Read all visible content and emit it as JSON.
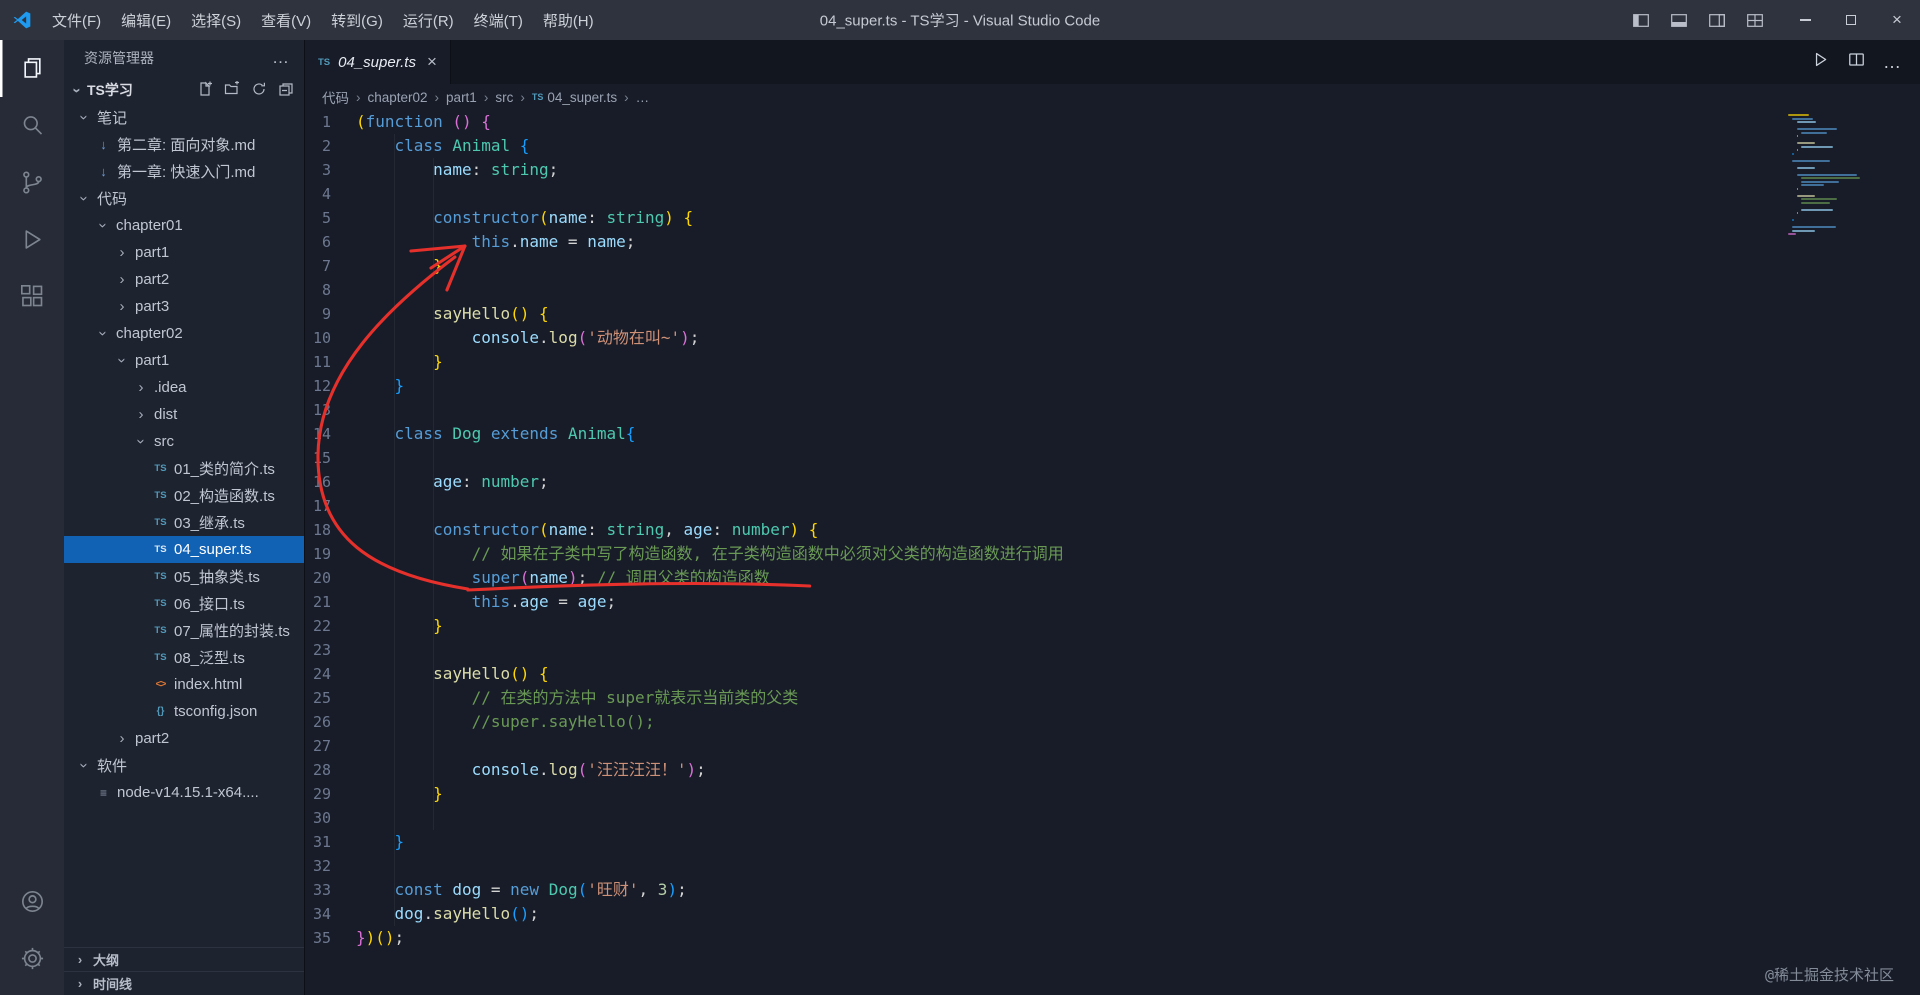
{
  "window": {
    "title": "04_super.ts - TS学习 - Visual Studio Code",
    "menus": [
      "文件(F)",
      "编辑(E)",
      "选择(S)",
      "查看(V)",
      "转到(G)",
      "运行(R)",
      "终端(T)",
      "帮助(H)"
    ]
  },
  "activity_bar": {
    "items": [
      "explorer",
      "search",
      "source-control",
      "run-debug",
      "extensions"
    ],
    "bottom": [
      "account",
      "settings"
    ]
  },
  "sidebar": {
    "title": "资源管理器",
    "section": "TS学习",
    "tree": [
      {
        "label": "笔记",
        "depth": 0,
        "kind": "folder",
        "expanded": true
      },
      {
        "label": "第二章: 面向对象.md",
        "depth": 1,
        "kind": "md"
      },
      {
        "label": "第一章: 快速入门.md",
        "depth": 1,
        "kind": "md"
      },
      {
        "label": "代码",
        "depth": 0,
        "kind": "folder",
        "expanded": true
      },
      {
        "label": "chapter01",
        "depth": 1,
        "kind": "folder",
        "expanded": true
      },
      {
        "label": "part1",
        "depth": 2,
        "kind": "folder",
        "expanded": false
      },
      {
        "label": "part2",
        "depth": 2,
        "kind": "folder",
        "expanded": false
      },
      {
        "label": "part3",
        "depth": 2,
        "kind": "folder",
        "expanded": false
      },
      {
        "label": "chapter02",
        "depth": 1,
        "kind": "folder",
        "expanded": true
      },
      {
        "label": "part1",
        "depth": 2,
        "kind": "folder",
        "expanded": true
      },
      {
        "label": ".idea",
        "depth": 3,
        "kind": "folder",
        "expanded": false
      },
      {
        "label": "dist",
        "depth": 3,
        "kind": "folder",
        "expanded": false
      },
      {
        "label": "src",
        "depth": 3,
        "kind": "folder",
        "expanded": true
      },
      {
        "label": "01_类的简介.ts",
        "depth": 4,
        "kind": "ts"
      },
      {
        "label": "02_构造函数.ts",
        "depth": 4,
        "kind": "ts"
      },
      {
        "label": "03_继承.ts",
        "depth": 4,
        "kind": "ts"
      },
      {
        "label": "04_super.ts",
        "depth": 4,
        "kind": "ts",
        "selected": true
      },
      {
        "label": "05_抽象类.ts",
        "depth": 4,
        "kind": "ts"
      },
      {
        "label": "06_接口.ts",
        "depth": 4,
        "kind": "ts"
      },
      {
        "label": "07_属性的封装.ts",
        "depth": 4,
        "kind": "ts"
      },
      {
        "label": "08_泛型.ts",
        "depth": 4,
        "kind": "ts"
      },
      {
        "label": "index.html",
        "depth": 4,
        "kind": "html"
      },
      {
        "label": "tsconfig.json",
        "depth": 4,
        "kind": "json"
      },
      {
        "label": "part2",
        "depth": 2,
        "kind": "folder",
        "expanded": false
      },
      {
        "label": "软件",
        "depth": 0,
        "kind": "folder",
        "expanded": true
      },
      {
        "label": "node-v14.15.1-x64....",
        "depth": 1,
        "kind": "file"
      }
    ],
    "panels": [
      "大纲",
      "时间线"
    ]
  },
  "editor": {
    "tab": {
      "label": "04_super.ts"
    },
    "breadcrumbs": [
      {
        "label": "代码"
      },
      {
        "label": "chapter02"
      },
      {
        "label": "part1"
      },
      {
        "label": "src"
      },
      {
        "label": "04_super.ts",
        "icon": "ts"
      },
      {
        "label": "…"
      }
    ],
    "line_count": 35,
    "lines": [
      [
        [
          "b1",
          "("
        ],
        [
          "kw",
          "function"
        ],
        [
          "pln",
          " "
        ],
        [
          "b2",
          "()"
        ],
        [
          "pln",
          " "
        ],
        [
          "b2",
          "{"
        ]
      ],
      [
        [
          "pln",
          "    "
        ],
        [
          "kw",
          "class"
        ],
        [
          "pln",
          " "
        ],
        [
          "cls",
          "Animal"
        ],
        [
          "pln",
          " "
        ],
        [
          "b3",
          "{"
        ]
      ],
      [
        [
          "pln",
          "        "
        ],
        [
          "prop",
          "name"
        ],
        [
          "pln",
          ": "
        ],
        [
          "cls",
          "string"
        ],
        [
          "pln",
          ";"
        ]
      ],
      [],
      [
        [
          "pln",
          "        "
        ],
        [
          "kw",
          "constructor"
        ],
        [
          "b1",
          "("
        ],
        [
          "prop",
          "name"
        ],
        [
          "pln",
          ": "
        ],
        [
          "cls",
          "string"
        ],
        [
          "b1",
          ")"
        ],
        [
          "pln",
          " "
        ],
        [
          "b1",
          "{"
        ]
      ],
      [
        [
          "pln",
          "            "
        ],
        [
          "kw",
          "this"
        ],
        [
          "pln",
          "."
        ],
        [
          "prop",
          "name"
        ],
        [
          "pln",
          " = "
        ],
        [
          "prop",
          "name"
        ],
        [
          "pln",
          ";"
        ]
      ],
      [
        [
          "pln",
          "        "
        ],
        [
          "b1",
          "}"
        ]
      ],
      [],
      [
        [
          "pln",
          "        "
        ],
        [
          "fn",
          "sayHello"
        ],
        [
          "b1",
          "()"
        ],
        [
          "pln",
          " "
        ],
        [
          "b1",
          "{"
        ]
      ],
      [
        [
          "pln",
          "            "
        ],
        [
          "prop",
          "console"
        ],
        [
          "pln",
          "."
        ],
        [
          "fn",
          "log"
        ],
        [
          "b2",
          "("
        ],
        [
          "str",
          "'动物在叫~'"
        ],
        [
          "b2",
          ")"
        ],
        [
          "pln",
          ";"
        ]
      ],
      [
        [
          "pln",
          "        "
        ],
        [
          "b1",
          "}"
        ]
      ],
      [
        [
          "pln",
          "    "
        ],
        [
          "b3",
          "}"
        ]
      ],
      [],
      [
        [
          "pln",
          "    "
        ],
        [
          "kw",
          "class"
        ],
        [
          "pln",
          " "
        ],
        [
          "cls",
          "Dog"
        ],
        [
          "pln",
          " "
        ],
        [
          "kw",
          "extends"
        ],
        [
          "pln",
          " "
        ],
        [
          "cls",
          "Animal"
        ],
        [
          "b3",
          "{"
        ]
      ],
      [],
      [
        [
          "pln",
          "        "
        ],
        [
          "prop",
          "age"
        ],
        [
          "pln",
          ": "
        ],
        [
          "cls",
          "number"
        ],
        [
          "pln",
          ";"
        ]
      ],
      [],
      [
        [
          "pln",
          "        "
        ],
        [
          "kw",
          "constructor"
        ],
        [
          "b1",
          "("
        ],
        [
          "prop",
          "name"
        ],
        [
          "pln",
          ": "
        ],
        [
          "cls",
          "string"
        ],
        [
          "pln",
          ", "
        ],
        [
          "prop",
          "age"
        ],
        [
          "pln",
          ": "
        ],
        [
          "cls",
          "number"
        ],
        [
          "b1",
          ")"
        ],
        [
          "pln",
          " "
        ],
        [
          "b1",
          "{"
        ]
      ],
      [
        [
          "pln",
          "            "
        ],
        [
          "cmt",
          "// 如果在子类中写了构造函数, 在子类构造函数中必须对父类的构造函数进行调用"
        ]
      ],
      [
        [
          "pln",
          "            "
        ],
        [
          "kw",
          "super"
        ],
        [
          "b2",
          "("
        ],
        [
          "prop",
          "name"
        ],
        [
          "b2",
          ")"
        ],
        [
          "pln",
          "; "
        ],
        [
          "cmt",
          "// 调用父类的构造函数"
        ]
      ],
      [
        [
          "pln",
          "            "
        ],
        [
          "kw",
          "this"
        ],
        [
          "pln",
          "."
        ],
        [
          "prop",
          "age"
        ],
        [
          "pln",
          " = "
        ],
        [
          "prop",
          "age"
        ],
        [
          "pln",
          ";"
        ]
      ],
      [
        [
          "pln",
          "        "
        ],
        [
          "b1",
          "}"
        ]
      ],
      [],
      [
        [
          "pln",
          "        "
        ],
        [
          "fn",
          "sayHello"
        ],
        [
          "b1",
          "()"
        ],
        [
          "pln",
          " "
        ],
        [
          "b1",
          "{"
        ]
      ],
      [
        [
          "pln",
          "            "
        ],
        [
          "cmt",
          "// 在类的方法中 super就表示当前类的父类"
        ]
      ],
      [
        [
          "pln",
          "            "
        ],
        [
          "cmt",
          "//super.sayHello();"
        ]
      ],
      [],
      [
        [
          "pln",
          "            "
        ],
        [
          "prop",
          "console"
        ],
        [
          "pln",
          "."
        ],
        [
          "fn",
          "log"
        ],
        [
          "b2",
          "("
        ],
        [
          "str",
          "'汪汪汪汪！'"
        ],
        [
          "b2",
          ")"
        ],
        [
          "pln",
          ";"
        ]
      ],
      [
        [
          "pln",
          "        "
        ],
        [
          "b1",
          "}"
        ]
      ],
      [],
      [
        [
          "pln",
          "    "
        ],
        [
          "b3",
          "}"
        ]
      ],
      [],
      [
        [
          "pln",
          "    "
        ],
        [
          "kw",
          "const"
        ],
        [
          "pln",
          " "
        ],
        [
          "var",
          "dog"
        ],
        [
          "pln",
          " = "
        ],
        [
          "kw",
          "new"
        ],
        [
          "pln",
          " "
        ],
        [
          "cls",
          "Dog"
        ],
        [
          "b3",
          "("
        ],
        [
          "str",
          "'旺财'"
        ],
        [
          "pln",
          ", "
        ],
        [
          "num",
          "3"
        ],
        [
          "b3",
          ")"
        ],
        [
          "pln",
          ";"
        ]
      ],
      [
        [
          "pln",
          "    "
        ],
        [
          "var",
          "dog"
        ],
        [
          "pln",
          "."
        ],
        [
          "fn",
          "sayHello"
        ],
        [
          "b3",
          "()"
        ],
        [
          "pln",
          ";"
        ]
      ],
      [
        [
          "b2",
          "}"
        ],
        [
          "b1",
          ")()"
        ],
        [
          "pln",
          ";"
        ]
      ]
    ]
  },
  "colors": {
    "annotation_red": "#e5302b",
    "selection_blue": "#1161b5",
    "ts_icon_blue": "#519aba",
    "tokens": {
      "kw": "#569cd6",
      "cls": "#4ec9b0",
      "prop": "#9cdcfe",
      "fn": "#dcdcaa",
      "str": "#ce9178",
      "cmt": "#6a9955",
      "num": "#b5cea8",
      "pln": "#d4d4d4",
      "var": "#9cdcfe",
      "b1": "#ffd700",
      "b2": "#da70d6",
      "b3": "#179fff"
    }
  },
  "file_icon_glyphs": {
    "ts": "TS",
    "md": "↓",
    "html": "<>",
    "json": "{}",
    "file": "≡"
  },
  "watermark": "@稀土掘金技术社区"
}
